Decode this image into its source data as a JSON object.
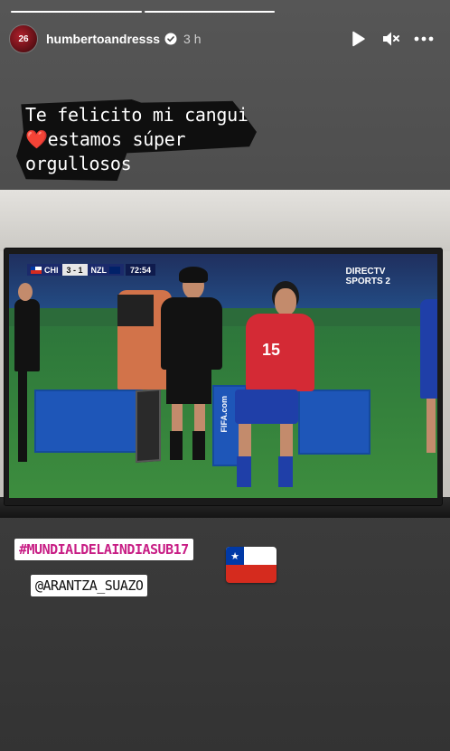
{
  "story": {
    "progress_segments": [
      {
        "fill": 1.0
      },
      {
        "fill": 1.0
      },
      {
        "fill": 0.0
      }
    ]
  },
  "header": {
    "username": "humbertoandresss",
    "time": "3 h",
    "avatar_badge": "26",
    "icons": [
      "play-icon",
      "mute-icon",
      "more-icon"
    ]
  },
  "caption": {
    "line1": "Te felicito mi cangui",
    "heart": "❤️",
    "line2": "estamos súper",
    "line3": "orgullosos"
  },
  "tv": {
    "team_home": "CHI",
    "score": "3 - 1",
    "team_away": "NZL",
    "clock": "72:54",
    "channel_line1": "DIRECTV",
    "channel_line2": "SPORTS 2",
    "board_text": "FIFA.com",
    "jersey_number": "15"
  },
  "stickers": {
    "hashtag": "#MUNDIALDELAINDIASUB17",
    "mention": "@ARANTZA_SUAZO",
    "flag_star": "★"
  },
  "colors": {
    "hashtag_color": "#c81e85",
    "heart_color": "#e0212c",
    "chile_red": "#d52b1e",
    "chile_blue": "#0039a6"
  }
}
